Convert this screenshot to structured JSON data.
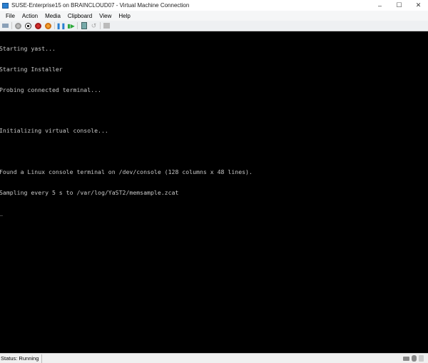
{
  "window": {
    "title": "SUSE-Enterprise15 on BRAINCLOUD07 - Virtual Machine Connection",
    "minimize": "–",
    "maximize": "☐",
    "close": "✕"
  },
  "menu": [
    "File",
    "Action",
    "Media",
    "Clipboard",
    "View",
    "Help"
  ],
  "terminal": {
    "lines": [
      "Starting yast...",
      "Starting Installer",
      "Probing connected terminal...",
      "",
      "Initializing virtual console...",
      "",
      "Found a Linux console terminal on /dev/console (128 columns x 48 lines).",
      "Sampling every 5 s to /var/log/YaST2/memsample.zcat",
      "_"
    ]
  },
  "status": {
    "text": "Status: Running"
  },
  "colors": {
    "start": "#999999",
    "turnoff": "#222222",
    "shutdown": "#d22d2d",
    "save": "#e68a1a",
    "pause": "#2a7fd0",
    "resume": "#2eaa3c"
  }
}
